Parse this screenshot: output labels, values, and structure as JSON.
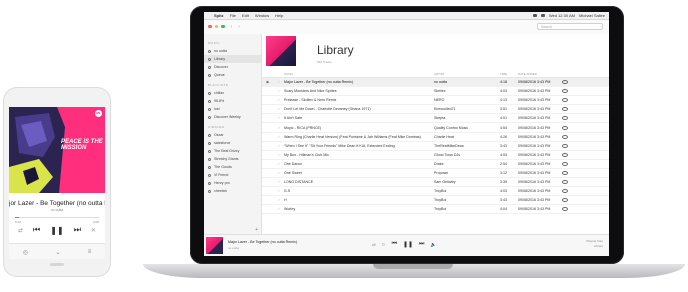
{
  "laptop": {
    "menubar": {
      "app_name": "Spitz",
      "menus": [
        "File",
        "Edit",
        "Window",
        "Help"
      ],
      "clock": "Wed 12:30 AM",
      "user": "Michael Sallee"
    },
    "search_placeholder": "Search",
    "sidebar": {
      "music_heading": "MUSIC",
      "music_items": [
        "no outta",
        "Library",
        "Discover",
        "Queue"
      ],
      "playlists_heading": "PLAYLISTS",
      "playlist_items": [
        "chillax",
        "96.8%",
        "lost",
        "Discover Weekly"
      ],
      "circles_heading": "CIRCLES",
      "circle_items": [
        "Oscar",
        "salesforce",
        "The Best Drizzy",
        "Stretchy Giants",
        "The Goods",
        "Vi Friend",
        "Henry pro",
        "cheetah"
      ]
    },
    "library": {
      "title": "Library",
      "subtitle": "640 Tracks",
      "columns": {
        "song": "SONG",
        "artist": "ARTIST",
        "time": "TIME",
        "date": "DATE ADDED"
      },
      "rows": [
        {
          "song": "Major Lazer - Be Together (no outta Remix)",
          "artist": "no outta",
          "time": "4:18",
          "date": "09/08/2016 3:43 PM"
        },
        {
          "song": "Scary Monsters And Nice Sprites",
          "artist": "Skrillex",
          "time": "4:03",
          "date": "09/08/2016 3:43 PM"
        },
        {
          "song": "Prelease - Skrillex & Nero Remix",
          "artist": "NERO",
          "time": "4:13",
          "date": "09/08/2016 3:43 PM"
        },
        {
          "song": "Don't Let Me Down - Charlotte Devaney (Ghana 1971)",
          "artist": "Kimsoulled71",
          "time": "3:51",
          "date": "09/08/2016 3:43 PM"
        },
        {
          "song": "It Ain't Safe",
          "artist": "Skepta",
          "time": "4:01",
          "date": "09/08/2016 3:43 PM"
        },
        {
          "song": "Mopic - RICA (PRNCE)",
          "artist": "Quality Control Music",
          "time": "4:54",
          "date": "09/08/2016 3:43 PM"
        },
        {
          "song": "Warm Ring (Charlie Heat Version) (Feat Pontaine & Jah Williams (Feat Mike Dombas)",
          "artist": "Charlie Heat",
          "time": "4:26",
          "date": "09/08/2016 3:43 PM"
        },
        {
          "song": "\"When I See It\" \"Sit Your Friends\" Mike Dean ft KIA, Extended Ending",
          "artist": "TheRealMikeDean",
          "time": "3:43",
          "date": "09/08/2016 3:43 PM"
        },
        {
          "song": "My Boo - Hillman's Club Mix",
          "artist": "Ghost Town DJs",
          "time": "4:53",
          "date": "09/08/2016 3:43 PM"
        },
        {
          "song": "One Dance",
          "artist": "Drake",
          "time": "2:54",
          "date": "09/08/2016 3:43 PM"
        },
        {
          "song": "One Sweet",
          "artist": "Propown",
          "time": "3:12",
          "date": "09/08/2016 3:43 PM"
        },
        {
          "song": "LONG DISTANCE",
          "artist": "Sam Gellaitry",
          "time": "3:39",
          "date": "09/08/2016 3:43 PM"
        },
        {
          "song": "G.S",
          "artist": "TroyBoi",
          "time": "4:03",
          "date": "09/08/2016 3:43 PM"
        },
        {
          "song": "H",
          "artist": "TroyBoi",
          "time": "3:43",
          "date": "09/08/2016 3:43 PM"
        },
        {
          "song": "Worley",
          "artist": "TroyBoi",
          "time": "4:04",
          "date": "09/08/2016 3:43 PM"
        }
      ]
    },
    "player": {
      "title": "Major Lazer - Be Together (no outta Remix)",
      "subtitle": "no outta",
      "right_line1": "Playing from",
      "right_line2": "Library"
    }
  },
  "phone": {
    "art_title": "PEACE IS THE MISSION",
    "art_logo": "ML",
    "title": "jor Lazer - Be Together (no outta Remix",
    "subtitle": "no outta",
    "time_elapsed": "0:12",
    "time_remaining": "-4:06",
    "progress": 0.05
  }
}
